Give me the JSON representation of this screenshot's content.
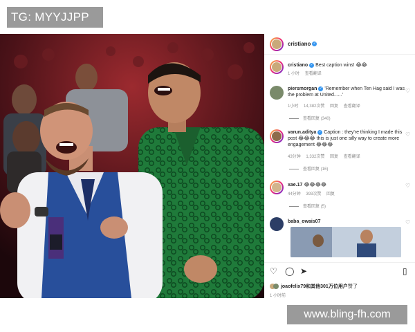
{
  "badge": {
    "text": "TG: MYYJJPP"
  },
  "watermark": {
    "text": "www.bling-fh.com"
  },
  "post": {
    "author": "cristiano",
    "caption_author": "cristiano",
    "caption": "Best caption wins! 😂😂",
    "caption_time": "1 小时",
    "caption_translate": "查看翻译"
  },
  "comments": [
    {
      "user": "piersmorgan",
      "text": "'Remember when Ten Hag said I was the problem at United......'",
      "time": "1小时",
      "likes": "14,382次赞",
      "reply": "回复",
      "translate": "查看翻译",
      "view_replies": "查看回复 (340)"
    },
    {
      "user": "varun.aditya",
      "text": "Caption : they're thinking I made this post 😂😂😂 this is just one silly way to create more engagement 😂😂😂",
      "time": "43分钟",
      "likes": "1,332次赞",
      "reply": "回复",
      "translate": "查看翻译",
      "view_replies": "查看回复 (16)"
    },
    {
      "user": "xae.17",
      "text": "😂😂😂😂",
      "time": "44分钟",
      "likes": "393次赞",
      "reply": "回复",
      "translate": "",
      "view_replies": "查看回复 (5)"
    },
    {
      "user": "baba_owais07",
      "text": "",
      "time": "",
      "likes": "",
      "reply": "",
      "translate": "",
      "view_replies": ""
    }
  ],
  "footer": {
    "liked_by_user": "joaofelix79",
    "liked_by_rest": "和其他301万位用户",
    "liked_by_suffix": "赞了",
    "time": "1 小时前"
  },
  "icons": {
    "like": "heart-icon",
    "comment": "comment-icon",
    "share": "share-icon",
    "save": "bookmark-icon",
    "verified": "verified-badge-icon"
  }
}
